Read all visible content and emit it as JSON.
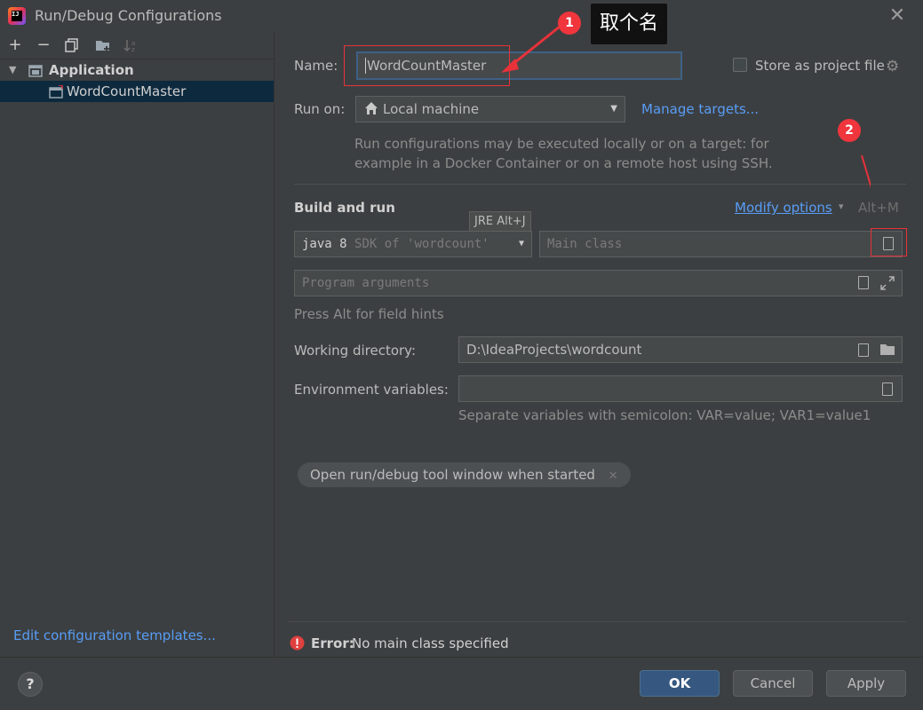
{
  "window": {
    "title": "Run/Debug Configurations"
  },
  "toolbar": {
    "add": "+",
    "remove": "−",
    "copy_icon": "copy-icon",
    "folder_icon": "new-folder-icon",
    "sort_icon": "sort-icon"
  },
  "tree": {
    "group_label": "Application",
    "items": [
      {
        "label": "WordCountMaster"
      }
    ]
  },
  "sidebar": {
    "edit_templates": "Edit configuration templates..."
  },
  "form": {
    "name_label": "Name:",
    "name_value": "WordCountMaster",
    "store_label": "Store as project file",
    "run_on_label": "Run on:",
    "run_on_value": "Local machine",
    "manage_targets": "Manage targets...",
    "run_on_hint_line1": "Run configurations may be executed locally or on a target: for",
    "run_on_hint_line2": "example in a Docker Container or on a remote host using SSH.",
    "build_run_title": "Build and run",
    "modify_options": "Modify options",
    "modify_shortcut": "Alt+M",
    "jre_tooltip": "JRE Alt+J",
    "sdk_java": "java 8",
    "sdk_rest": "SDK of 'wordcount'",
    "main_class_placeholder": "Main class",
    "program_args_placeholder": "Program arguments",
    "field_hints": "Press Alt for field hints",
    "working_dir_label": "Working directory:",
    "working_dir_value": "D:\\IdeaProjects\\wordcount",
    "env_vars_label": "Environment variables:",
    "env_vars_value": "",
    "env_vars_hint": "Separate variables with semicolon: VAR=value; VAR1=value1",
    "open_tool_window_chip": "Open run/debug tool window when started",
    "error_label": "Error:",
    "error_message": "No main class specified"
  },
  "buttons": {
    "ok": "OK",
    "cancel": "Cancel",
    "apply": "Apply",
    "help": "?"
  },
  "annotations": {
    "badge1": "1",
    "badge2": "2",
    "callout1": "取个名"
  },
  "colors": {
    "accent": "#589df6",
    "error": "#e8323a",
    "selection": "#0d293e",
    "primary_button": "#365880"
  }
}
